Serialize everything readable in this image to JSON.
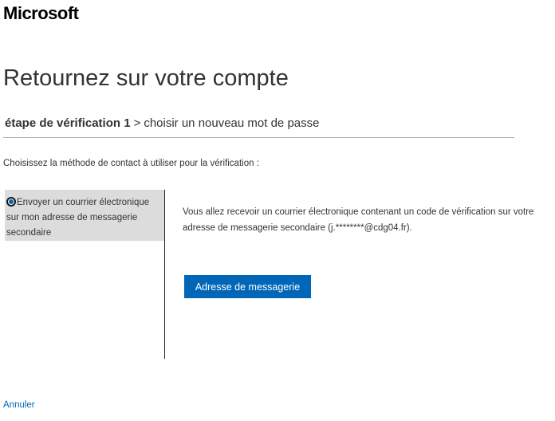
{
  "header": {
    "logo_text": "Microsoft"
  },
  "main": {
    "title": "Retournez sur votre compte",
    "steps": {
      "current": "étape de vérification 1",
      "separator": ">",
      "next": "choisir un nouveau mot de passe"
    },
    "instruction": "Choisissez la méthode de contact à utiliser pour la vérification :",
    "methods": [
      {
        "label": "Envoyer un courrier électronique sur mon adresse de messagerie secondaire",
        "selected": true
      }
    ],
    "description": "Vous allez recevoir un courrier électronique contenant un code de vérification sur votre adresse de messagerie secondaire (j.********@cdg04.fr).",
    "primary_button": "Adresse de messagerie",
    "cancel_link": "Annuler"
  },
  "colors": {
    "accent": "#0067b8",
    "selected_bg": "#dcdcdc"
  }
}
